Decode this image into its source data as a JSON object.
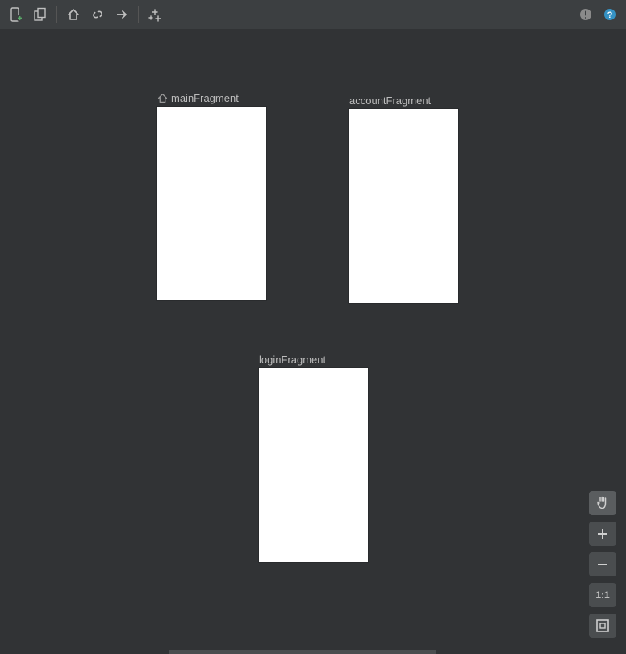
{
  "toolbar": {
    "icons": {
      "new_destination": "new-destination-icon",
      "nested_graph": "nested-graph-icon",
      "home": "home-icon",
      "link": "link-icon",
      "arrow": "arrow-right-icon",
      "autoarrange": "auto-arrange-icon",
      "warning": "warning-icon",
      "help": "help-icon"
    }
  },
  "destinations": {
    "main": {
      "label": "mainFragment",
      "is_start": true
    },
    "account": {
      "label": "accountFragment",
      "is_start": false
    },
    "login": {
      "label": "loginFragment",
      "is_start": false
    }
  },
  "zoom": {
    "pan": "pan-icon",
    "zoom_in": "zoom-in-icon",
    "zoom_out": "zoom-out-icon",
    "actual": "1:1",
    "fit": "zoom-fit-icon"
  }
}
